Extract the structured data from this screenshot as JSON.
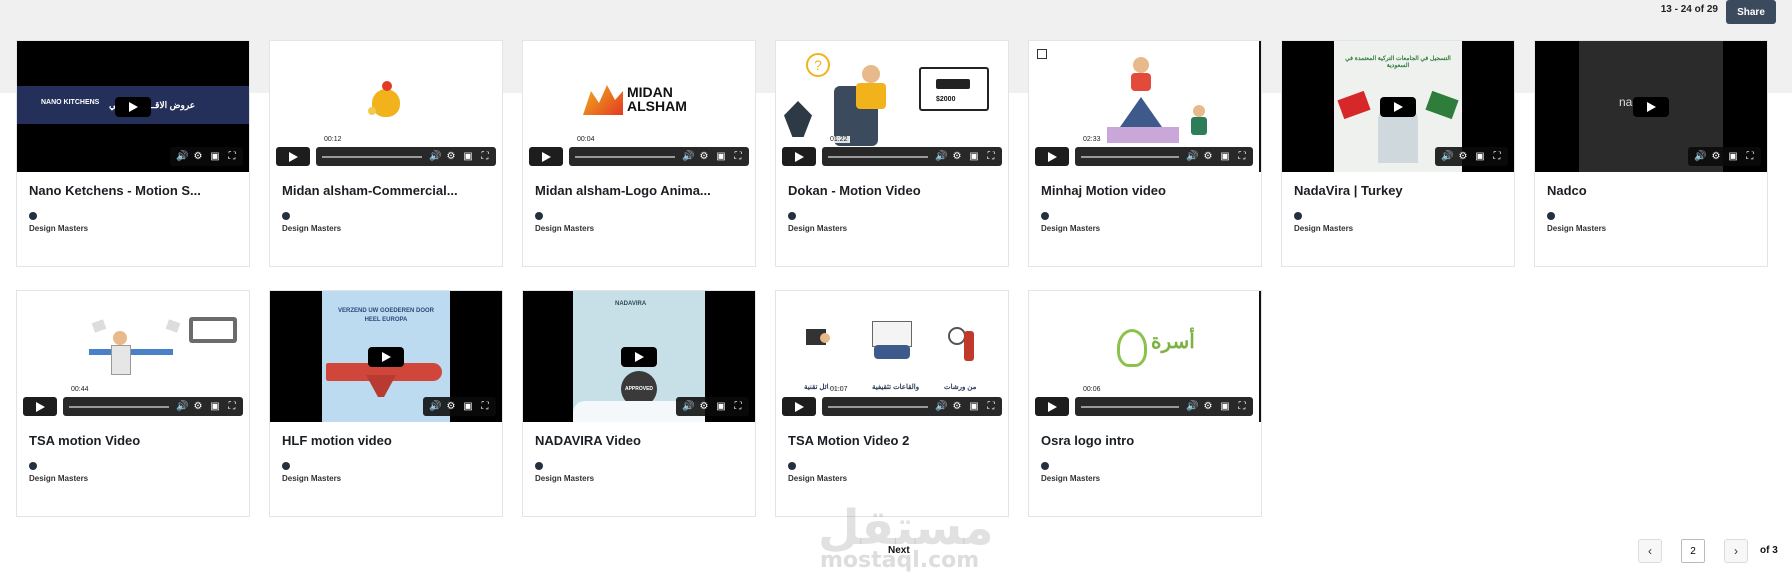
{
  "header": {
    "range_text": "13 - 24 of 29",
    "share_label": "Share"
  },
  "owner_name": "Design Masters",
  "cards": [
    {
      "title": "Nano Ketchens - Motion S...",
      "time": "",
      "thumb_text": "عروض الاقــ ـم الوطني",
      "brand": "NANO KITCHENS"
    },
    {
      "title": "Midan alsham-Commercial...",
      "time": "00:12",
      "thumb_text": ""
    },
    {
      "title": "Midan alsham-Logo Anima...",
      "time": "00:04",
      "thumb_text": "MIDAN ALSHAM"
    },
    {
      "title": "Dokan - Motion Video",
      "time": "01:22",
      "thumb_text": "$2000"
    },
    {
      "title": "Minhaj Motion video",
      "time": "02:33",
      "thumb_text": ""
    },
    {
      "title": "NadaVira | Turkey",
      "time": "",
      "thumb_text": "التسجيل في الجامعات التركية المعتمدة في السعودية"
    },
    {
      "title": "Nadco",
      "time": "",
      "thumb_text": "nadcou"
    },
    {
      "title": "TSA motion Video",
      "time": "00:44",
      "thumb_text": ""
    },
    {
      "title": "HLF motion video",
      "time": "",
      "thumb_text": "VERZEND UW GOEDEREN DOOR HEEL EUROPA"
    },
    {
      "title": "NADAVIRA Video",
      "time": "",
      "thumb_text": "NADAVIRA",
      "stamp": "APPROVED"
    },
    {
      "title": "TSA Motion Video 2",
      "time": "01:07",
      "thumb_text": "ومسائل تقنية",
      "thumb_text_2": "والقاعات تثقيفية",
      "thumb_text_3": "من ورشات"
    },
    {
      "title": "Osra logo intro",
      "time": "00:06",
      "thumb_text": "أسرة"
    }
  ],
  "pagination": {
    "next_label": "Next",
    "prev_icon": "‹",
    "next_icon": "›",
    "page_value": "2",
    "of_text": "of 3"
  },
  "watermark": {
    "arabic": "مستقل",
    "latin": "mostaql.com"
  },
  "colors": {
    "share_bg": "#3b4a5c",
    "avatar": "#22303f",
    "top_band": "#f0f0f0"
  }
}
